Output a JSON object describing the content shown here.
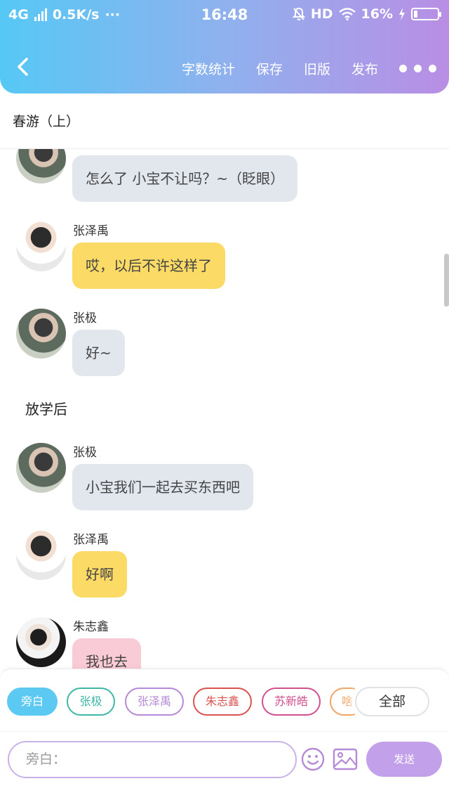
{
  "status_bar": {
    "network": "4G",
    "speed": "0.5K/s",
    "extra": "···",
    "time": "16:48",
    "hd": "HD",
    "battery": "16%"
  },
  "toolbar": {
    "word_count_label": "字数统计",
    "save_label": "保存",
    "old_version_label": "旧版",
    "publish_label": "发布"
  },
  "document": {
    "title": "春游（上）"
  },
  "messages": [
    {
      "speaker": "",
      "text": "怎么了 小宝不让吗？~（眨眼）"
    },
    {
      "speaker": "张泽禹",
      "text": "哎，以后不许这样了"
    },
    {
      "speaker": "张极",
      "text": "好~"
    },
    {
      "narration": "放学后"
    },
    {
      "speaker": "张极",
      "text": "小宝我们一起去买东西吧"
    },
    {
      "speaker": "张泽禹",
      "text": "好啊"
    },
    {
      "speaker": "朱志鑫",
      "text": "我也去"
    }
  ],
  "character_chips": [
    {
      "label": "旁白",
      "color": "#5cc9f2"
    },
    {
      "label": "张极",
      "color": "#3fb7a6"
    },
    {
      "label": "张泽禹",
      "color": "#b58ad8"
    },
    {
      "label": "朱志鑫",
      "color": "#d9534f"
    },
    {
      "label": "苏新皓",
      "color": "#d1518f"
    },
    {
      "label": "啥",
      "color": "#f0a567"
    }
  ],
  "all_chip_label": "全部",
  "input": {
    "placeholder": "旁白："
  },
  "send_label": "发送"
}
